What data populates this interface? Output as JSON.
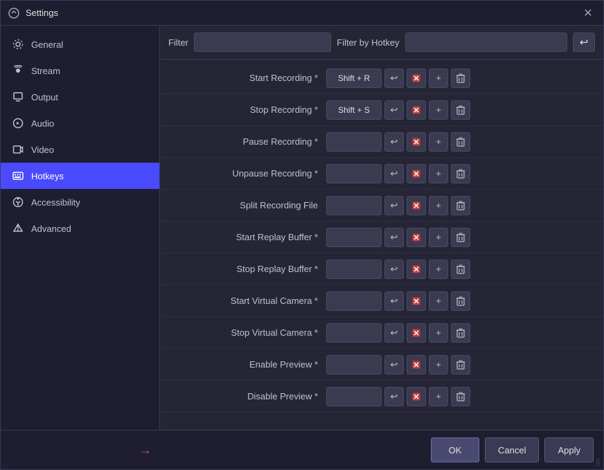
{
  "window": {
    "title": "Settings",
    "close_label": "✕"
  },
  "sidebar": {
    "items": [
      {
        "id": "general",
        "label": "General",
        "icon": "⚙",
        "active": false
      },
      {
        "id": "stream",
        "label": "Stream",
        "icon": "📡",
        "active": false
      },
      {
        "id": "output",
        "label": "Output",
        "icon": "🖥",
        "active": false
      },
      {
        "id": "audio",
        "label": "Audio",
        "icon": "🔊",
        "active": false
      },
      {
        "id": "video",
        "label": "Video",
        "icon": "⬜",
        "active": false
      },
      {
        "id": "hotkeys",
        "label": "Hotkeys",
        "icon": "⌨",
        "active": true
      },
      {
        "id": "accessibility",
        "label": "Accessibility",
        "icon": "♿",
        "active": false
      },
      {
        "id": "advanced",
        "label": "Advanced",
        "icon": "✳",
        "active": false
      }
    ]
  },
  "filter_bar": {
    "filter_label": "Filter",
    "filter_placeholder": "",
    "hotkey_label": "Filter by Hotkey",
    "hotkey_placeholder": "",
    "back_icon": "↩"
  },
  "hotkeys": {
    "rows": [
      {
        "name": "Start Recording *",
        "binding": "Shift + R"
      },
      {
        "name": "Stop Recording *",
        "binding": "Shift + S"
      },
      {
        "name": "Pause Recording *",
        "binding": ""
      },
      {
        "name": "Unpause Recording *",
        "binding": ""
      },
      {
        "name": "Split Recording File",
        "binding": ""
      },
      {
        "name": "Start Replay Buffer *",
        "binding": ""
      },
      {
        "name": "Stop Replay Buffer *",
        "binding": ""
      },
      {
        "name": "Start Virtual Camera *",
        "binding": ""
      },
      {
        "name": "Stop Virtual Camera *",
        "binding": ""
      },
      {
        "name": "Enable Preview *",
        "binding": ""
      },
      {
        "name": "Disable Preview *",
        "binding": ""
      }
    ],
    "icons": {
      "undo": "↩",
      "clear": "✕",
      "add": "+",
      "delete": "🗑"
    }
  },
  "footer": {
    "ok_label": "OK",
    "cancel_label": "Cancel",
    "apply_label": "Apply",
    "arrow": "→"
  }
}
